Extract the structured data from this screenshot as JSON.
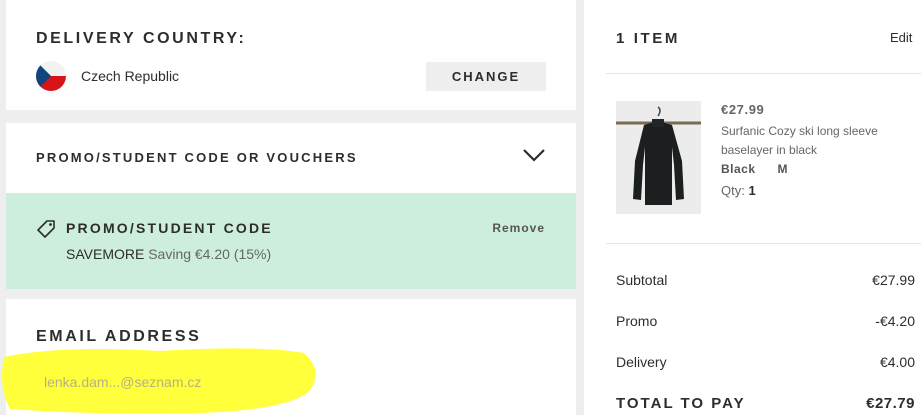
{
  "delivery": {
    "title": "DELIVERY COUNTRY:",
    "country": "Czech Republic",
    "flag_icon": "czech-flag-icon",
    "change_label": "CHANGE"
  },
  "promo_section": {
    "title": "PROMO/STUDENT CODE OR VOUCHERS",
    "toggle_icon": "chevron-down-icon"
  },
  "applied_promo": {
    "icon": "tag-icon",
    "title": "PROMO/STUDENT CODE",
    "remove_label": "Remove",
    "code": "SAVEMORE",
    "saving_text": "Saving €4.20 (15%)",
    "background_color": "#cdeedd"
  },
  "email": {
    "title": "EMAIL ADDRESS",
    "value": "lenka.dam...@seznam.cz",
    "highlight_color": "#ffff3c"
  },
  "bag": {
    "title": "1 ITEM",
    "edit_label": "Edit",
    "item": {
      "price": "€27.99",
      "name": "Surfanic Cozy ski long sleeve baselayer in black",
      "color": "Black",
      "size": "M",
      "qty_label": "Qty:",
      "qty": "1",
      "image_icon": "black-long-sleeve-top-on-hanger"
    }
  },
  "summary": {
    "subtotal_label": "Subtotal",
    "subtotal_value": "€27.99",
    "promo_label": "Promo",
    "promo_value": "-€4.20",
    "delivery_label": "Delivery",
    "delivery_value": "€4.00",
    "total_label": "TOTAL TO PAY",
    "total_value": "€27.79"
  }
}
